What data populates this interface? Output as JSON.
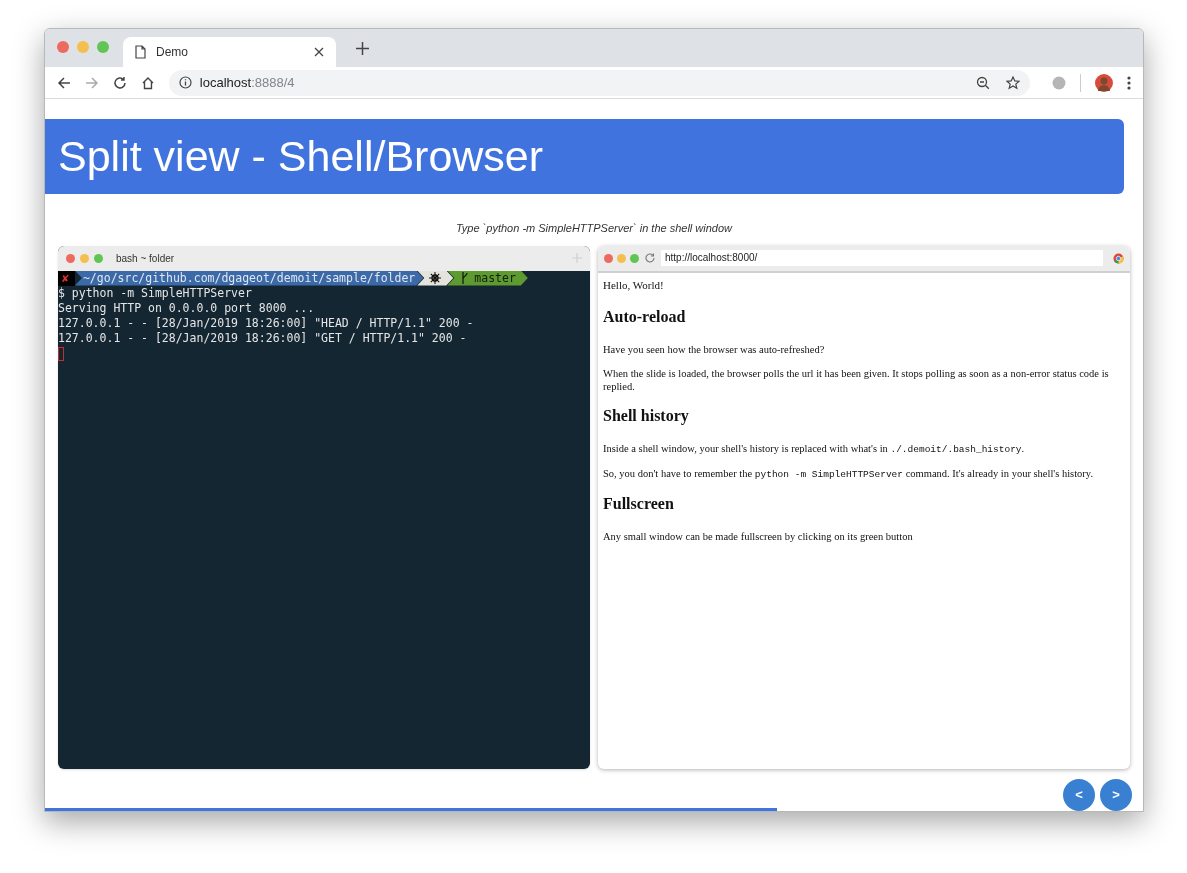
{
  "browser": {
    "tab": {
      "title": "Demo"
    },
    "address": {
      "host": "localhost",
      "path": ":8888/4"
    }
  },
  "slide": {
    "title": "Split view - Shell/Browser",
    "subtitle": "Type `python -m SimpleHTTPServer` in the shell window",
    "shell": {
      "title": "bash ~ folder",
      "prompt": {
        "status": "✘",
        "path": "~/go/src/github.com/dgageot/demoit/sample/folder",
        "branch": "master"
      },
      "lines": [
        "$ python -m SimpleHTTPServer",
        "Serving HTTP on 0.0.0.0 port 8000 ...",
        "127.0.0.1 - - [28/Jan/2019 18:26:00] \"HEAD / HTTP/1.1\" 200 -",
        "127.0.0.1 - - [28/Jan/2019 18:26:00] \"GET / HTTP/1.1\" 200 -"
      ]
    },
    "mini_browser": {
      "url": "http://localhost:8000/",
      "content": [
        {
          "kind": "text",
          "parts": [
            {
              "text": "Hello, World!",
              "code": false
            }
          ]
        },
        {
          "kind": "heading",
          "parts": [
            {
              "text": "Auto-reload",
              "code": false
            }
          ]
        },
        {
          "kind": "paragraph",
          "parts": [
            {
              "text": "Have you seen how the browser was auto-refreshed?",
              "code": false
            }
          ]
        },
        {
          "kind": "paragraph",
          "parts": [
            {
              "text": "When the slide is loaded, the browser polls the url it has been given. It stops polling as soon as a non-error status code is replied.",
              "code": false
            }
          ]
        },
        {
          "kind": "heading",
          "parts": [
            {
              "text": "Shell history",
              "code": false
            }
          ]
        },
        {
          "kind": "paragraph",
          "parts": [
            {
              "text": "Inside a shell window, your shell's history is replaced with what's in ",
              "code": false
            },
            {
              "text": "./.demoit/.bash_history",
              "code": true
            },
            {
              "text": ".",
              "code": false
            }
          ]
        },
        {
          "kind": "paragraph",
          "parts": [
            {
              "text": "So, you don't have to remember the ",
              "code": false
            },
            {
              "text": "python -m SimpleHTTPServer",
              "code": true
            },
            {
              "text": " command. It's already in your shell's history.",
              "code": false
            }
          ]
        },
        {
          "kind": "heading",
          "parts": [
            {
              "text": "Fullscreen",
              "code": false
            }
          ]
        },
        {
          "kind": "paragraph",
          "parts": [
            {
              "text": "Any small window can be made fullscreen by clicking on its green button",
              "code": false
            }
          ]
        }
      ]
    },
    "nav": [
      "<",
      ">"
    ],
    "progress": {
      "level": 0.667
    }
  }
}
